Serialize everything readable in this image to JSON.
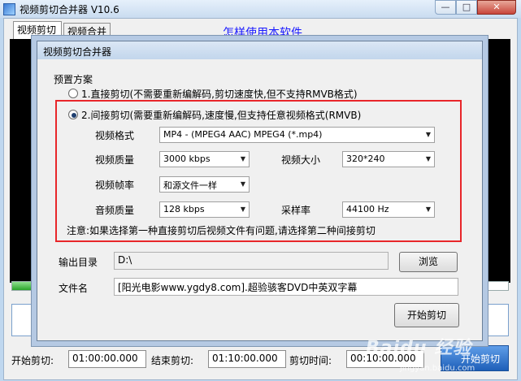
{
  "window": {
    "title": "视频剪切合并器 V10.6",
    "min_label": "—",
    "max_label": "□",
    "close_label": "✕"
  },
  "tabs": [
    "视频剪切",
    "视频合并"
  ],
  "help_link": "怎样使用本软件",
  "progress": 0.04,
  "bottom": {
    "start_label": "开始剪切:",
    "start_value": "01:00:00.000",
    "end_label": "结束剪切:",
    "end_value": "01:10:00.000",
    "duration_label": "剪切时间:",
    "duration_value": "00:10:00.000",
    "start_button": "开始剪切"
  },
  "dialog": {
    "title": "视频剪切合并器",
    "preset_label": "预置方案",
    "option_direct": "1.直接剪切(不需要重新编解码,剪切速度快,但不支持RMVB格式)",
    "option_indirect": "2.间接剪切(需要重新编解码,速度慢,但支持任意视频格式(RMVB)",
    "selected_option": 2,
    "format_label": "视频格式",
    "format_value": "MP4 - (MPEG4 AAC) MPEG4 (*.mp4)",
    "quality_label": "视频质量",
    "quality_value": "3000 kbps",
    "size_label": "视频大小",
    "size_value": "320*240",
    "framerate_label": "视频帧率",
    "framerate_value": "和源文件一样",
    "audio_label": "音频质量",
    "audio_value": "128 kbps",
    "samplerate_label": "采样率",
    "samplerate_value": "44100 Hz",
    "note": "注意:如果选择第一种直接剪切后视频文件有问题,请选择第二种间接剪切",
    "output_label": "输出目录",
    "output_value": "D:\\",
    "browse_button": "浏览",
    "filename_label": "文件名",
    "filename_value": "[阳光电影www.ygdy8.com].超验骇客DVD中英双字幕",
    "start_button": "开始剪切"
  },
  "watermark": "Baidu 经验",
  "watermark_url": "jingyan.baidu.com",
  "colors": {
    "highlight_box": "#e8262a",
    "link": "#1a1aff"
  }
}
